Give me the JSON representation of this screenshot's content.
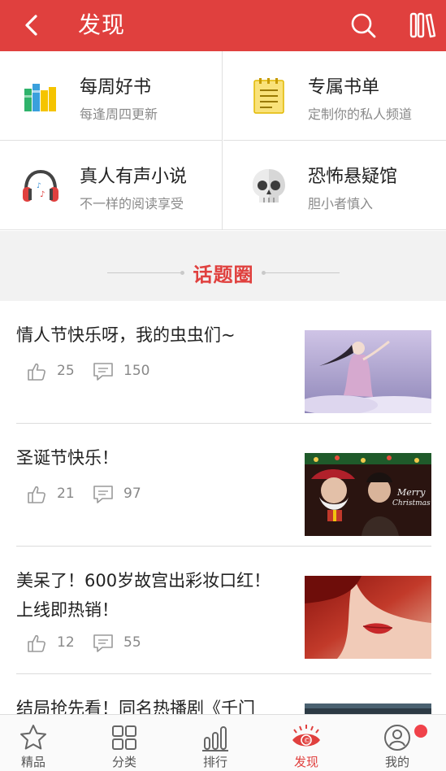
{
  "header": {
    "title": "发现",
    "back_icon": "chevron-left-icon",
    "search_icon": "search-icon",
    "bookshelf_icon": "bookshelf-icon",
    "background": "#e0403e"
  },
  "categories": [
    {
      "title": "每周好书",
      "subtitle": "每逢周四更新",
      "icon": "books-icon"
    },
    {
      "title": "专属书单",
      "subtitle": "定制你的私人频道",
      "icon": "notepad-icon"
    },
    {
      "title": "真人有声小说",
      "subtitle": "不一样的阅读享受",
      "icon": "headphones-icon"
    },
    {
      "title": "恐怖悬疑馆",
      "subtitle": "胆小者慎入",
      "icon": "skull-icon"
    }
  ],
  "topic_section": {
    "label": "话题圈"
  },
  "posts": [
    {
      "title": "情人节快乐呀，我的虫虫们~",
      "likes": "25",
      "comments": "150"
    },
    {
      "title": "圣诞节快乐！",
      "likes": "21",
      "comments": "97"
    },
    {
      "title": "美呆了！600岁故宫出彩妆口红！上线即热销！",
      "likes": "12",
      "comments": "55"
    },
    {
      "title": "结局抢先看！同名热播剧《千门"
    }
  ],
  "bottom_nav": [
    {
      "label": "精品",
      "icon": "star-icon"
    },
    {
      "label": "分类",
      "icon": "grid-icon"
    },
    {
      "label": "排行",
      "icon": "bar-chart-icon"
    },
    {
      "label": "发现",
      "icon": "eye-icon",
      "active": true
    },
    {
      "label": "我的",
      "icon": "user-icon",
      "has_badge": true
    }
  ],
  "colors": {
    "accent": "#e0403e",
    "badge": "#f0424a",
    "muted_text": "#8a8a8a"
  }
}
